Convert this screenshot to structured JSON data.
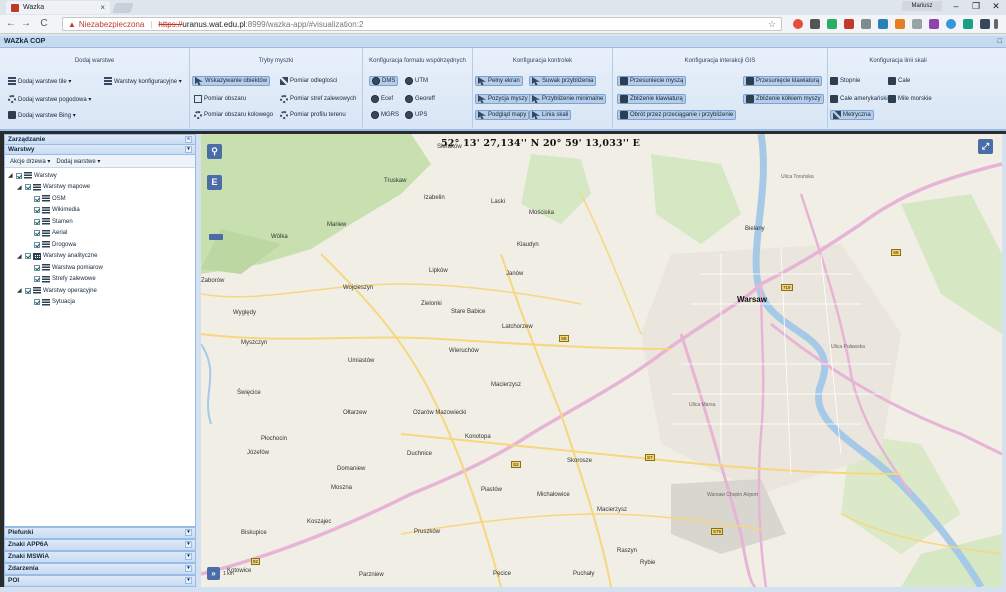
{
  "browser": {
    "tab_title": "Wazka",
    "tab_close": "×",
    "user": "Mariusz",
    "win_min": "–",
    "win_max": "❐",
    "win_close": "✕",
    "back": "←",
    "forward": "→",
    "reload": "C",
    "url_warning_icon": "▲",
    "url_security": "Niezabezpieczona",
    "url_scheme": "https://",
    "url_host": "uranus.wat.edu.pl",
    "url_path": ":8999/wazka-app/#visualization:2",
    "star": "☆"
  },
  "app": {
    "title": "WAZkA COP",
    "header_controls": "□"
  },
  "ribbon": {
    "groups": [
      {
        "title": "Dodaj warstwe",
        "buttons": [
          "Dodaj warstwe tile ▾",
          "Warstwy konfiguracyjne ▾",
          "Dodaj warstwe pogodowa ▾",
          "Dodaj warstwe Bing ▾"
        ]
      },
      {
        "title": "Tryby myszki",
        "buttons": [
          "Wskazywanie obiektów",
          "Pomiar odleglości",
          "Pomiar obszaru",
          "Pomiar stref zalewowych",
          "Pomiar obszaru kolowego",
          "Pomiar profilu terenu"
        ]
      },
      {
        "title": "Konfiguracja formatu współrzędnych",
        "buttons": [
          "DMS",
          "UTM",
          "Ecef",
          "Georeff",
          "MGRS",
          "UPS"
        ]
      },
      {
        "title": "Konfiguracja kontrolek",
        "buttons": [
          "Pełny ekran",
          "Suwak przybliżenia",
          "Pozycja myszy",
          "Przybliżenie minimalne",
          "Podgląd mapy",
          "Linia skali"
        ]
      },
      {
        "title": "Konfiguracja interakcji GIS",
        "buttons": [
          "Przesuniecie myszą",
          "Przesunięcie klawiaturą",
          "Zbliżenie klawiaturą",
          "Zbliżenie kółkiem myszy",
          "Obrót przez przeciąganie i przybliżenie"
        ]
      },
      {
        "title": "Konfiguracja linii skali",
        "buttons": [
          "Stopnie",
          "Cale",
          "Cale amerykańskie",
          "Mile morskie",
          "Metryczna"
        ]
      }
    ]
  },
  "left_panel": {
    "management_title": "Zarządzanie",
    "layers_title": "Warstwy",
    "toolbar": {
      "tree_actions": "Akcje drzewa ▾",
      "add_layer": "Dodaj warstwe ▾"
    },
    "tree": [
      {
        "label": "Warstwy",
        "level": 0,
        "type": "root"
      },
      {
        "label": "Warstwy mapowe",
        "level": 1,
        "type": "group"
      },
      {
        "label": "OSM",
        "level": 2,
        "type": "layer"
      },
      {
        "label": "Wikimedia",
        "level": 2,
        "type": "layer"
      },
      {
        "label": "Stamen",
        "level": 2,
        "type": "layer"
      },
      {
        "label": "Aerial",
        "level": 2,
        "type": "layer"
      },
      {
        "label": "Drogowa",
        "level": 2,
        "type": "layer"
      },
      {
        "label": "Warstwy analityczne",
        "level": 1,
        "type": "group-grid"
      },
      {
        "label": "Warstwa pomiarow",
        "level": 2,
        "type": "layer"
      },
      {
        "label": "Strefy zalewowe",
        "level": 2,
        "type": "layer"
      },
      {
        "label": "Warstwy operacyjne",
        "level": 1,
        "type": "group"
      },
      {
        "label": "Sytuacja",
        "level": 2,
        "type": "layer"
      }
    ],
    "collapsed_panels": [
      "Plefunki",
      "Znaki APP6A",
      "Znaki MSWiA",
      "Zdarzenia",
      "POI"
    ],
    "toggle_up": "«",
    "toggle_down": "▾"
  },
  "map": {
    "coordinates": "52° 13' 27,134'' N 20° 59' 13,033'' E",
    "search_btn": "⚲",
    "e_btn": "E",
    "fullscreen_btn": "⤢",
    "overview_btn": "»",
    "scale_label": "1 km",
    "city": "Warsaw",
    "places": [
      "Sieraków",
      "Truskaw",
      "Izabelin",
      "Laski",
      "Mościska",
      "Mariew",
      "Wólka",
      "Klaudyn",
      "Janów",
      "Zaborów",
      "Lipków",
      "Wojcieszyn",
      "Zielonki",
      "Stare Babice",
      "Latchorzew",
      "Wyględy",
      "Myszczyn",
      "Umiastów",
      "Wieruchów",
      "Święcice",
      "Macierzysz",
      "Ołtarzew",
      "Ożarów Mazowiecki",
      "Konotopa",
      "Płochocin",
      "Józefów",
      "Duchnice",
      "Domaniew",
      "Moszna",
      "Skorosze",
      "Piastów",
      "Michałowice",
      "Macierzysz",
      "Biskupice",
      "Koszajec",
      "Pruszków",
      "Raszyn",
      "Parzniew",
      "Pęcice",
      "Puchały",
      "Rybie",
      "Kotowice",
      "Bielany",
      "Warsaw Chopin Airport",
      "Ulica Toruńska",
      "Ulica Marsa",
      "Ulica Puławska"
    ],
    "roads": [
      "S8",
      "S8",
      "S2",
      "S79",
      "S7",
      "719",
      "92"
    ]
  },
  "colors": {
    "ribbon_border": "#99bbe8",
    "map_land": "#f1eee6",
    "forest": "#c8dfb0",
    "river": "#a7c9e8",
    "major_road": "#e7b4d6",
    "road": "#f6d77f"
  }
}
